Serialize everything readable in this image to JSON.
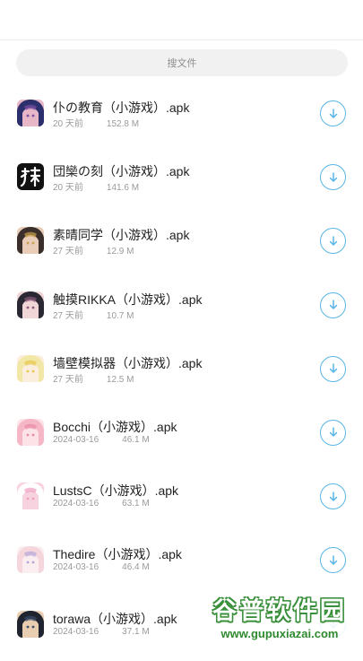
{
  "search": {
    "placeholder": "搜文件"
  },
  "files": [
    {
      "name": "仆の教育（小游戏）.apk",
      "date": "20 天前",
      "size": "152.8 M",
      "icon": "anime-girl-icon",
      "colors": [
        "#2b2f6b",
        "#e7b7c8",
        "#7a4fa3"
      ]
    },
    {
      "name": "団欒の刻（小游戏）.apk",
      "date": "20 天前",
      "size": "141.6 M",
      "icon": "glyph-logo-icon",
      "colors": [
        "#111111",
        "#ffffff",
        "#111111"
      ]
    },
    {
      "name": "素晴同学（小游戏）.apk",
      "date": "27 天前",
      "size": "12.9 M",
      "icon": "anime-girl-icon",
      "colors": [
        "#3a2f2a",
        "#e9cdb8",
        "#c9a14a"
      ]
    },
    {
      "name": "触摸RIKKA（小游戏）.apk",
      "date": "27 天前",
      "size": "10.7 M",
      "icon": "anime-girl-icon",
      "colors": [
        "#2a2833",
        "#f0d6d6",
        "#8a5a7a"
      ]
    },
    {
      "name": "墙壁模拟器（小游戏）.apk",
      "date": "27 天前",
      "size": "12.5 M",
      "icon": "anime-girl-icon",
      "colors": [
        "#f2e7a6",
        "#fbeede",
        "#e8c84a"
      ]
    },
    {
      "name": "Bocchi（小游戏）.apk",
      "date": "2024-03-16",
      "size": "46.1 M",
      "icon": "anime-girl-icon",
      "colors": [
        "#f5b6c6",
        "#fde3e8",
        "#e98aa6"
      ]
    },
    {
      "name": "LustsC（小游戏）.apk",
      "date": "2024-03-16",
      "size": "63.1 M",
      "icon": "anime-girl-icon",
      "colors": [
        "#ffffff",
        "#f7d3e0",
        "#f09fc0"
      ]
    },
    {
      "name": "Thedire（小游戏）.apk",
      "date": "2024-03-16",
      "size": "46.4 M",
      "icon": "anime-girl-icon",
      "colors": [
        "#f4d6dc",
        "#fbeef0",
        "#b7a7d9"
      ]
    },
    {
      "name": "torawa（小游戏）.apk",
      "date": "2024-03-16",
      "size": "37.1 M",
      "icon": "anime-boy-icon",
      "colors": [
        "#1f2430",
        "#e8cdb0",
        "#3a4c6a"
      ]
    }
  ],
  "accent_color": "#5ab6e6",
  "watermark": {
    "title": "谷普软件园",
    "url": "www.gupuxiazai.com"
  }
}
